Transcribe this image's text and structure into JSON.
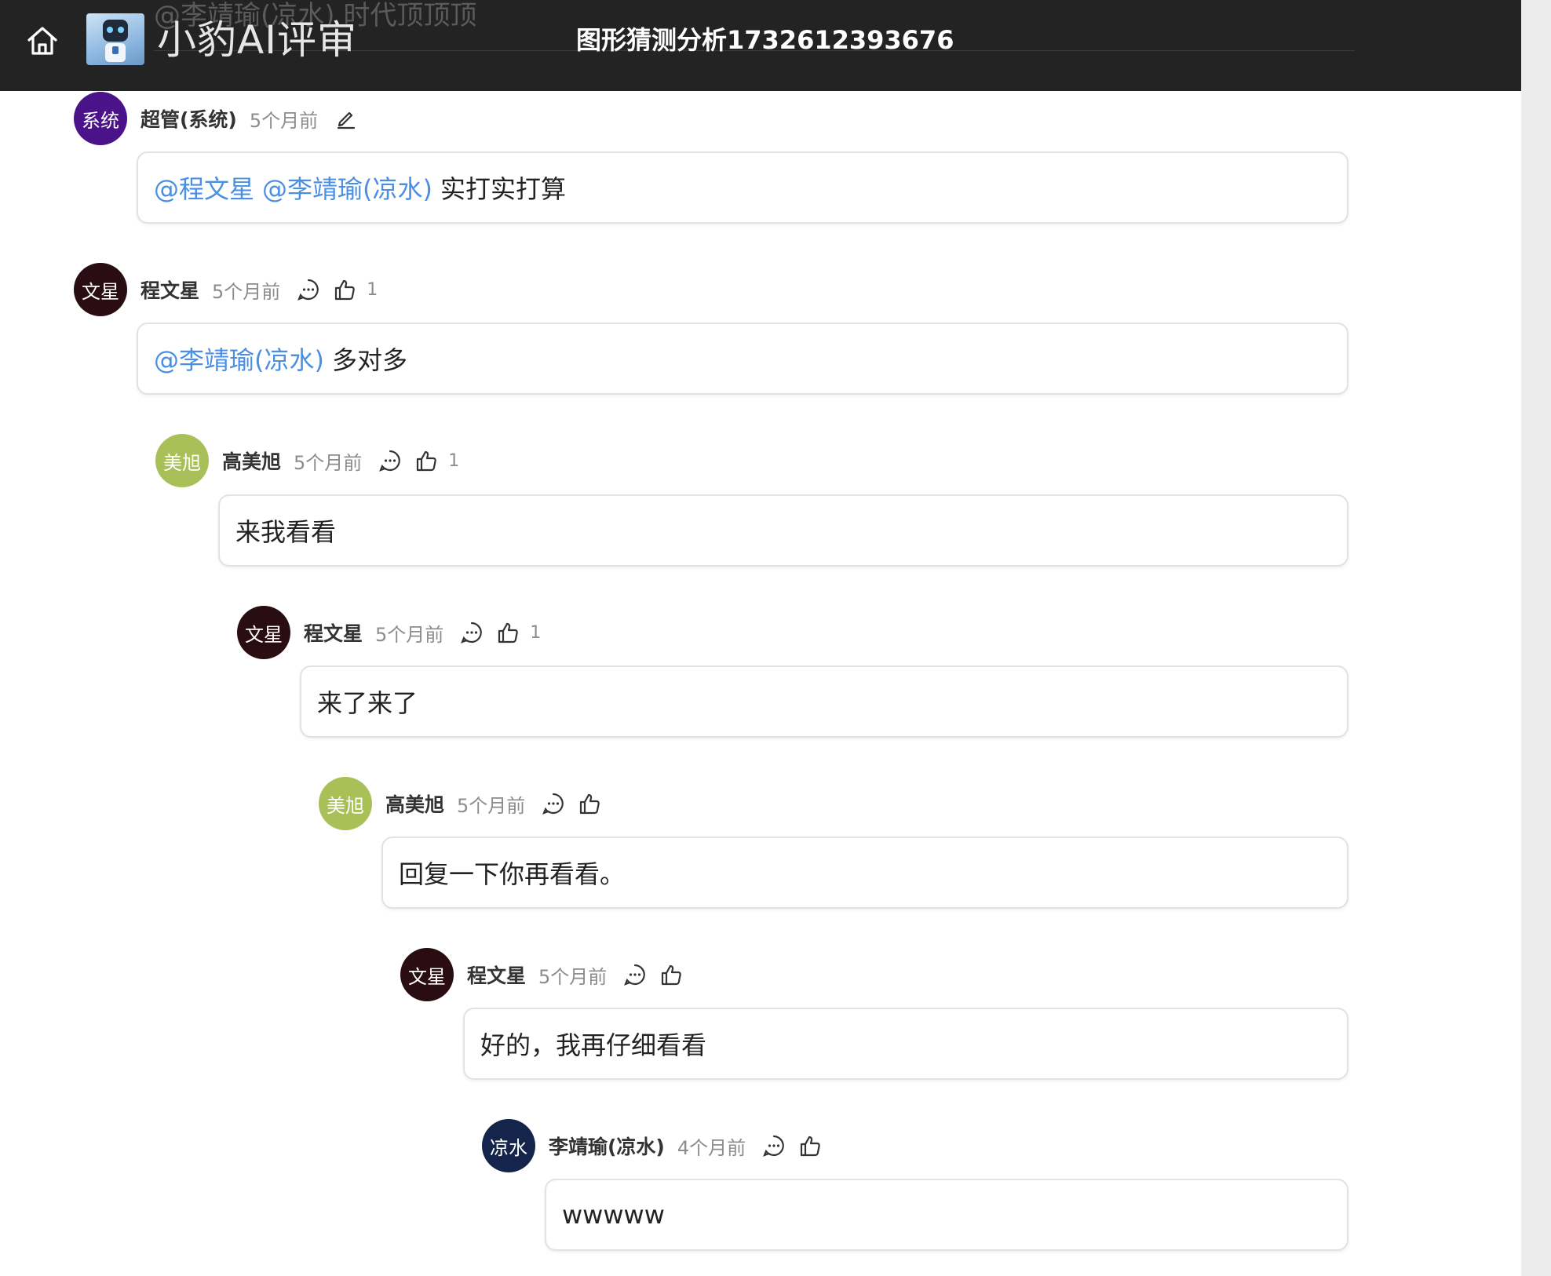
{
  "header": {
    "ghost_text": "@李靖瑜(凉水) 时代顶顶顶",
    "logo_title": "小豹AI评审",
    "page_title": "图形猜测分析1732612393676"
  },
  "comments": [
    {
      "avatar_text": "系统",
      "avatar_color": "#4a138a",
      "author": "超管(系统)",
      "time": "5个月前",
      "mentions": [
        "@程文星",
        "@李靖瑜(凉水)"
      ],
      "text": "实打实打算"
    },
    {
      "avatar_text": "文星",
      "avatar_color": "#2a0d12",
      "author": "程文星",
      "time": "5个月前",
      "likes": "1",
      "mentions": [
        "@李靖瑜(凉水)"
      ],
      "text": "多对多"
    },
    {
      "avatar_text": "美旭",
      "avatar_color": "#a8c057",
      "author": "高美旭",
      "time": "5个月前",
      "likes": "1",
      "text": "来我看看"
    },
    {
      "avatar_text": "文星",
      "avatar_color": "#2a0d12",
      "author": "程文星",
      "time": "5个月前",
      "likes": "1",
      "text": "来了来了"
    },
    {
      "avatar_text": "美旭",
      "avatar_color": "#a8c057",
      "author": "高美旭",
      "time": "5个月前",
      "text": "回复一下你再看看。"
    },
    {
      "avatar_text": "文星",
      "avatar_color": "#2a0d12",
      "author": "程文星",
      "time": "5个月前",
      "text": "好的，我再仔细看看"
    },
    {
      "avatar_text": "凉水",
      "avatar_color": "#14244a",
      "author": "李靖瑜(凉水)",
      "time": "4个月前",
      "text": "wwwww"
    }
  ]
}
